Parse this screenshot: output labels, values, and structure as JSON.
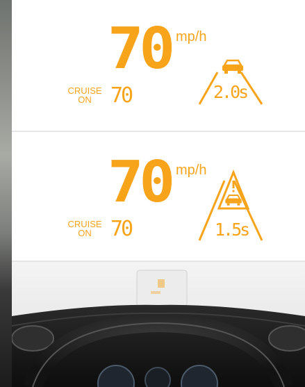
{
  "hud_top": {
    "speed": "70",
    "unit": "mp/h",
    "cruise_label": "CRUISE",
    "cruise_state": "ON",
    "cruise_speed": "70",
    "gap_time": "2.0s"
  },
  "hud_alert": {
    "speed": "70",
    "unit": "mp/h",
    "cruise_label": "CRUISE",
    "cruise_state": "ON",
    "cruise_speed": "70",
    "gap_time": "1.5s"
  },
  "colors": {
    "accent": "#F7A41B",
    "divider": "#E6E6E6"
  },
  "icons": [
    "car-ahead-icon",
    "lane-lines-icon",
    "warning-triangle-icon"
  ]
}
